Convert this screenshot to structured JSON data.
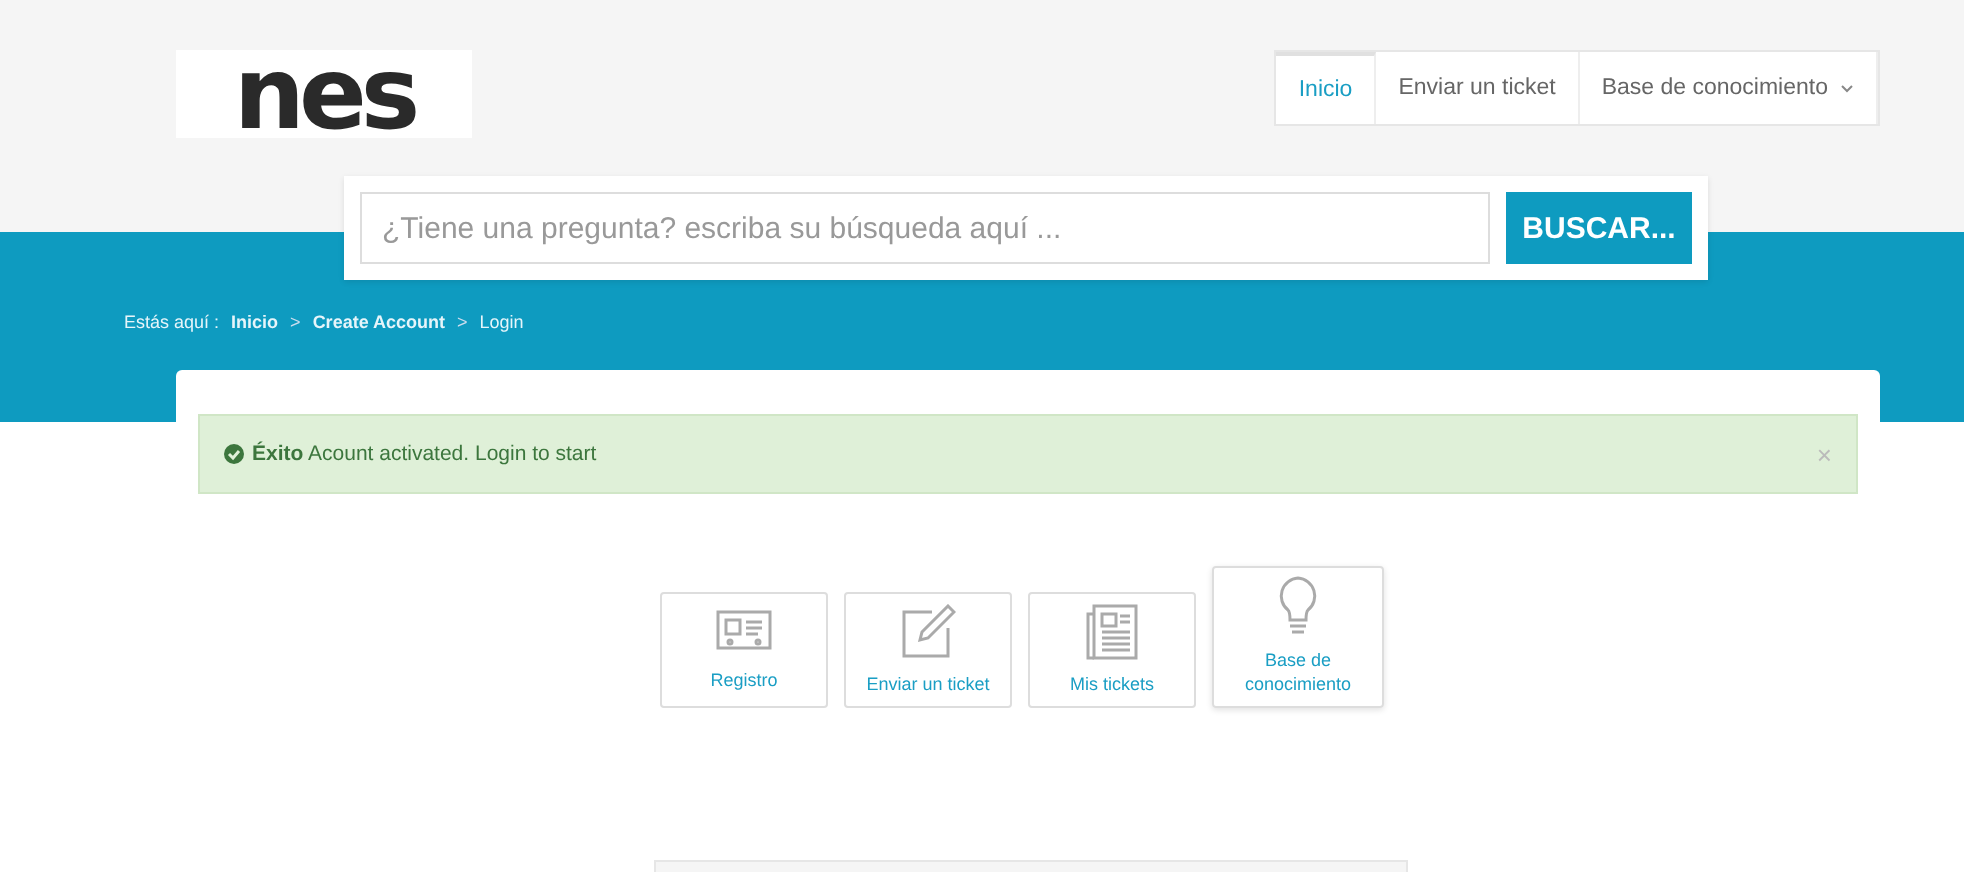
{
  "logo": {
    "text": "nes"
  },
  "nav": [
    {
      "label": "Inicio",
      "selected": true,
      "dropdown": false
    },
    {
      "label": "Enviar un ticket",
      "selected": false,
      "dropdown": false
    },
    {
      "label": "Base de conocimiento",
      "selected": false,
      "dropdown": true
    }
  ],
  "search": {
    "placeholder": "¿Tiene una pregunta? escriba su búsqueda aquí ...",
    "button": "BUSCAR..."
  },
  "breadcrumb": {
    "prefix": "Estás aquí :",
    "items": [
      {
        "label": "Inicio",
        "current": false
      },
      {
        "label": "Create Account",
        "current": false
      },
      {
        "label": "Login",
        "current": true
      }
    ],
    "separator": ">"
  },
  "alert": {
    "title": "Éxito",
    "message": "Acount activated. Login to start",
    "close": "×"
  },
  "tiles": [
    {
      "label": "Registro",
      "kind": "card",
      "selected": false
    },
    {
      "label": "Enviar un ticket",
      "kind": "edit",
      "selected": false
    },
    {
      "label": "Mis tickets",
      "kind": "news",
      "selected": false
    },
    {
      "label": "Base de conocimiento",
      "kind": "bulb",
      "selected": true
    }
  ]
}
